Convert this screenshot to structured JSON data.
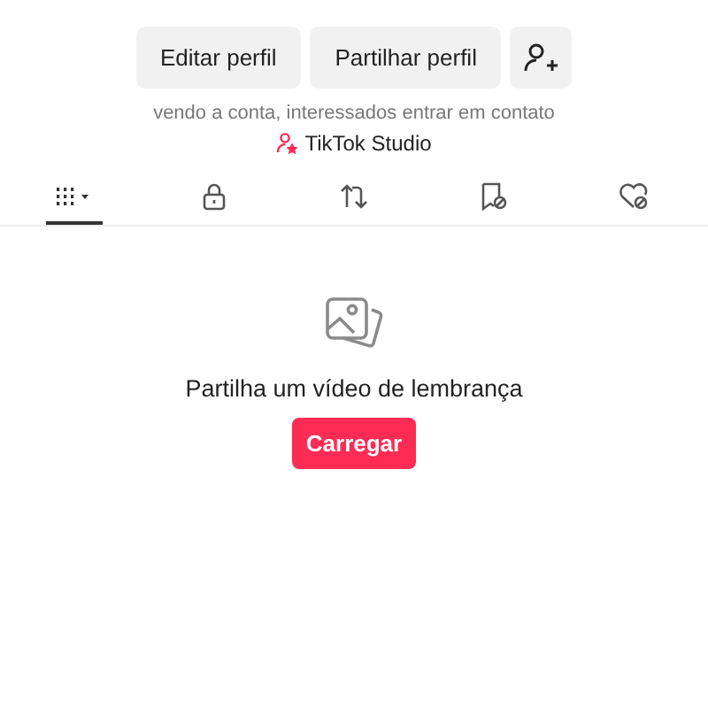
{
  "actions": [
    {
      "kind": "text",
      "label": "Editar perfil"
    },
    {
      "kind": "text",
      "label": "Partilhar perfil"
    },
    {
      "kind": "add-friend"
    }
  ],
  "bio": "vendo a conta, interessados entrar em contato",
  "studio_link": "TikTok Studio",
  "tabs": [
    {
      "kind": "grid",
      "selected": true
    },
    {
      "kind": "lock",
      "selected": false
    },
    {
      "kind": "repost",
      "selected": false
    },
    {
      "kind": "bookmark",
      "selected": false
    },
    {
      "kind": "liked",
      "selected": false
    }
  ],
  "empty_state": {
    "message": "Partilha um vídeo de lembrança",
    "button": "Carregar"
  }
}
